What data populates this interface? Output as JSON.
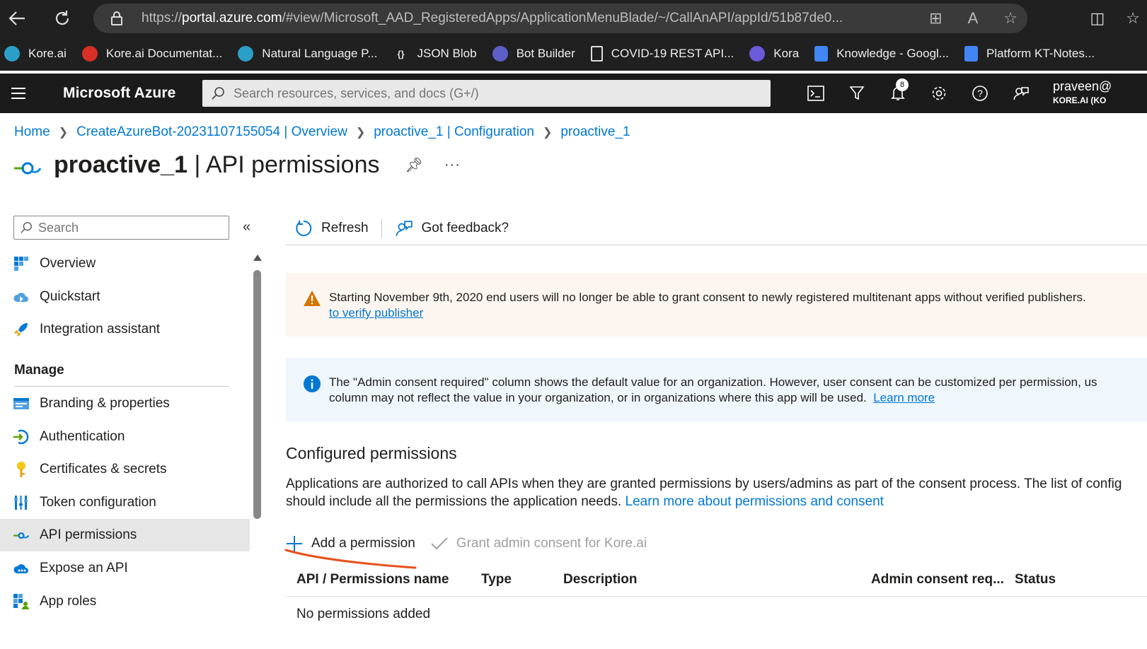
{
  "browser": {
    "url_prefix": "https://",
    "url_host": "portal.azure.com",
    "url_path": "/#view/Microsoft_AAD_RegisteredApps/ApplicationMenuBlade/~/CallAnAPI/appId/51b87de0..."
  },
  "bookmarks": [
    {
      "label": "Kore.ai",
      "icon": "kore-icon",
      "color": "#2aa0c8"
    },
    {
      "label": "Kore.ai Documentat...",
      "icon": "chrome-icon",
      "color": "#d93025"
    },
    {
      "label": "Natural Language P...",
      "icon": "nlp-icon",
      "color": "#2aa0c8"
    },
    {
      "label": "JSON Blob",
      "icon": "json-icon",
      "color": "#555"
    },
    {
      "label": "Bot Builder",
      "icon": "botbuilder-icon",
      "color": "#5b5fc7"
    },
    {
      "label": "COVID-19 REST API...",
      "icon": "page-icon",
      "color": "#ddd"
    },
    {
      "label": "Kora",
      "icon": "kora-icon",
      "color": "#6b5bd8"
    },
    {
      "label": "Knowledge - Googl...",
      "icon": "docs-icon",
      "color": "#4285f4"
    },
    {
      "label": "Platform KT-Notes...",
      "icon": "docs-icon",
      "color": "#4285f4"
    }
  ],
  "azure": {
    "brand": "Microsoft Azure",
    "search_placeholder": "Search resources, services, and docs (G+/)",
    "notification_count": "8",
    "account_name": "praveen@",
    "account_tenant": "KORE.AI (KO"
  },
  "breadcrumb": [
    "Home",
    "CreateAzureBot-20231107155054 | Overview",
    "proactive_1 | Configuration",
    "proactive_1"
  ],
  "page": {
    "title_app": "proactive_1",
    "title_rest": " | API permissions"
  },
  "leftnav": {
    "search_placeholder": "Search",
    "items_top": [
      "Overview",
      "Quickstart",
      "Integration assistant"
    ],
    "manage_header": "Manage",
    "items_manage": [
      "Branding & properties",
      "Authentication",
      "Certificates & secrets",
      "Token configuration",
      "API permissions",
      "Expose an API",
      "App roles"
    ],
    "selected": "API permissions"
  },
  "toolbar": {
    "refresh": "Refresh",
    "feedback": "Got feedback?"
  },
  "warning": {
    "line1": "Starting November 9th, 2020 end users will no longer be able to grant consent to newly registered multitenant apps without verified publishers.",
    "link": "to verify publisher"
  },
  "info": {
    "line1": "The \"Admin consent required\" column shows the default value for an organization. However, user consent can be customized per permission, us",
    "line2": "column may not reflect the value in your organization, or in organizations where this app will be used.",
    "link": "Learn more"
  },
  "configured": {
    "title": "Configured permissions",
    "desc_line1": "Applications are authorized to call APIs when they are granted permissions by users/admins as part of the consent process. The list of config",
    "desc_line2": "should include all the permissions the application needs.",
    "desc_link": "Learn more about permissions and consent",
    "add_permission": "Add a permission",
    "grant_consent": "Grant admin consent for Kore.ai",
    "columns": [
      "API / Permissions name",
      "Type",
      "Description",
      "Admin consent req...",
      "Status"
    ],
    "empty_text": "No permissions added"
  },
  "colors": {
    "accent": "#0078d4",
    "annotation": "#e8501a"
  }
}
